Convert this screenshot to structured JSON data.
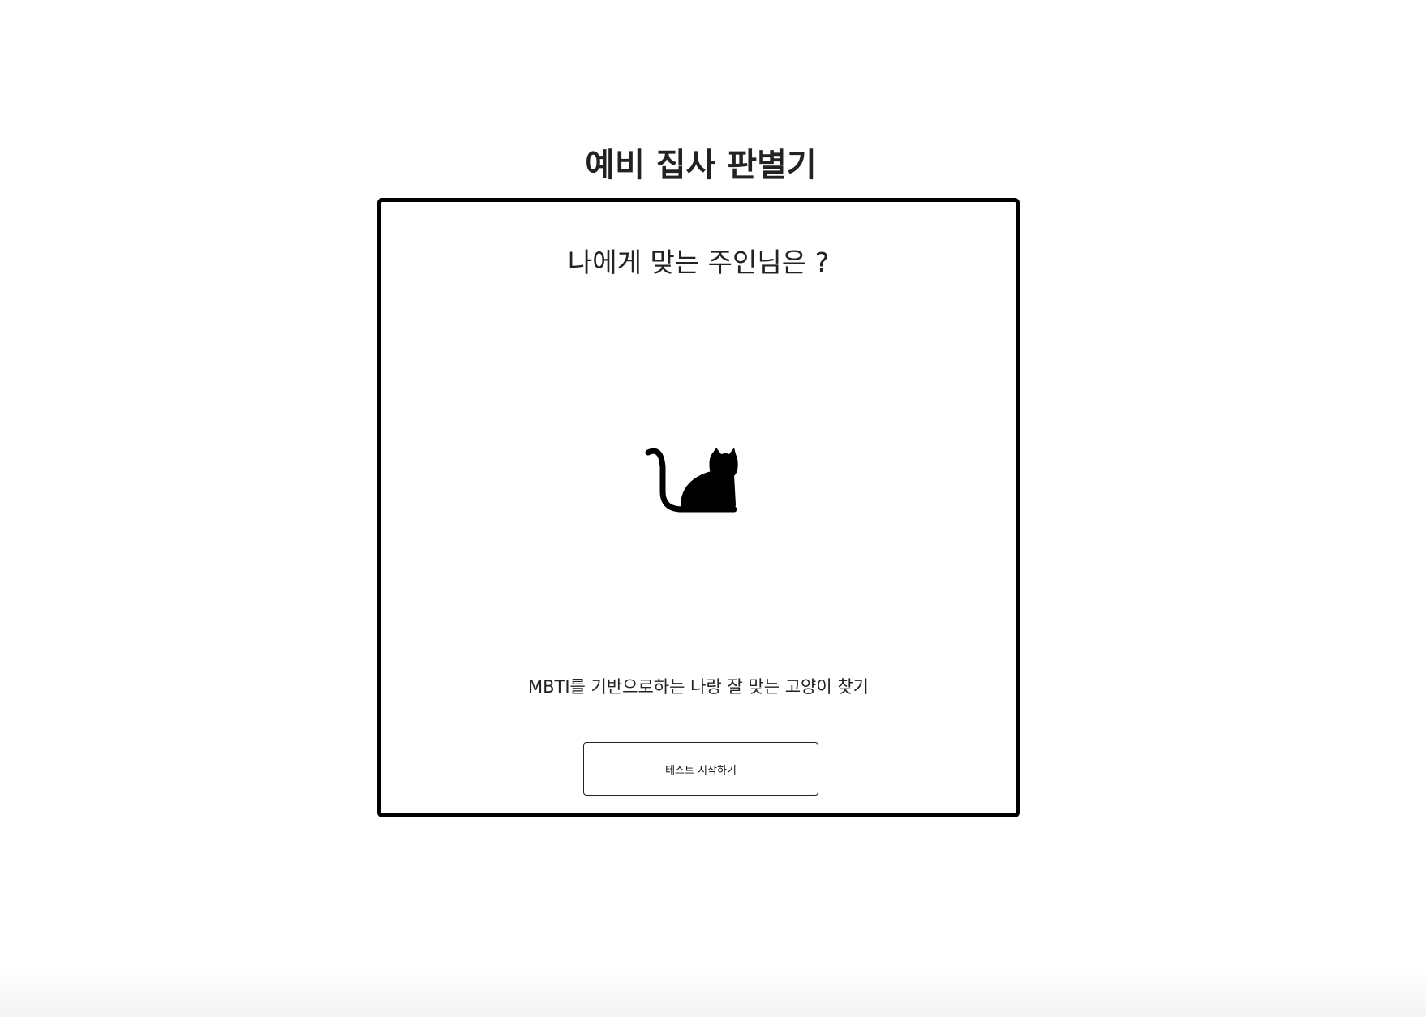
{
  "header": {
    "title": "예비 집사 판별기"
  },
  "card": {
    "question": "나에게 맞는 주인님은 ?",
    "illustration": "cat-icon",
    "description": "MBTI를 기반으로하는 나랑 잘 맞는 고양이 찾기",
    "start_button_label": "테스트 시작하기"
  },
  "colors": {
    "border": "#000000",
    "text": "#222222",
    "background": "#ffffff"
  }
}
